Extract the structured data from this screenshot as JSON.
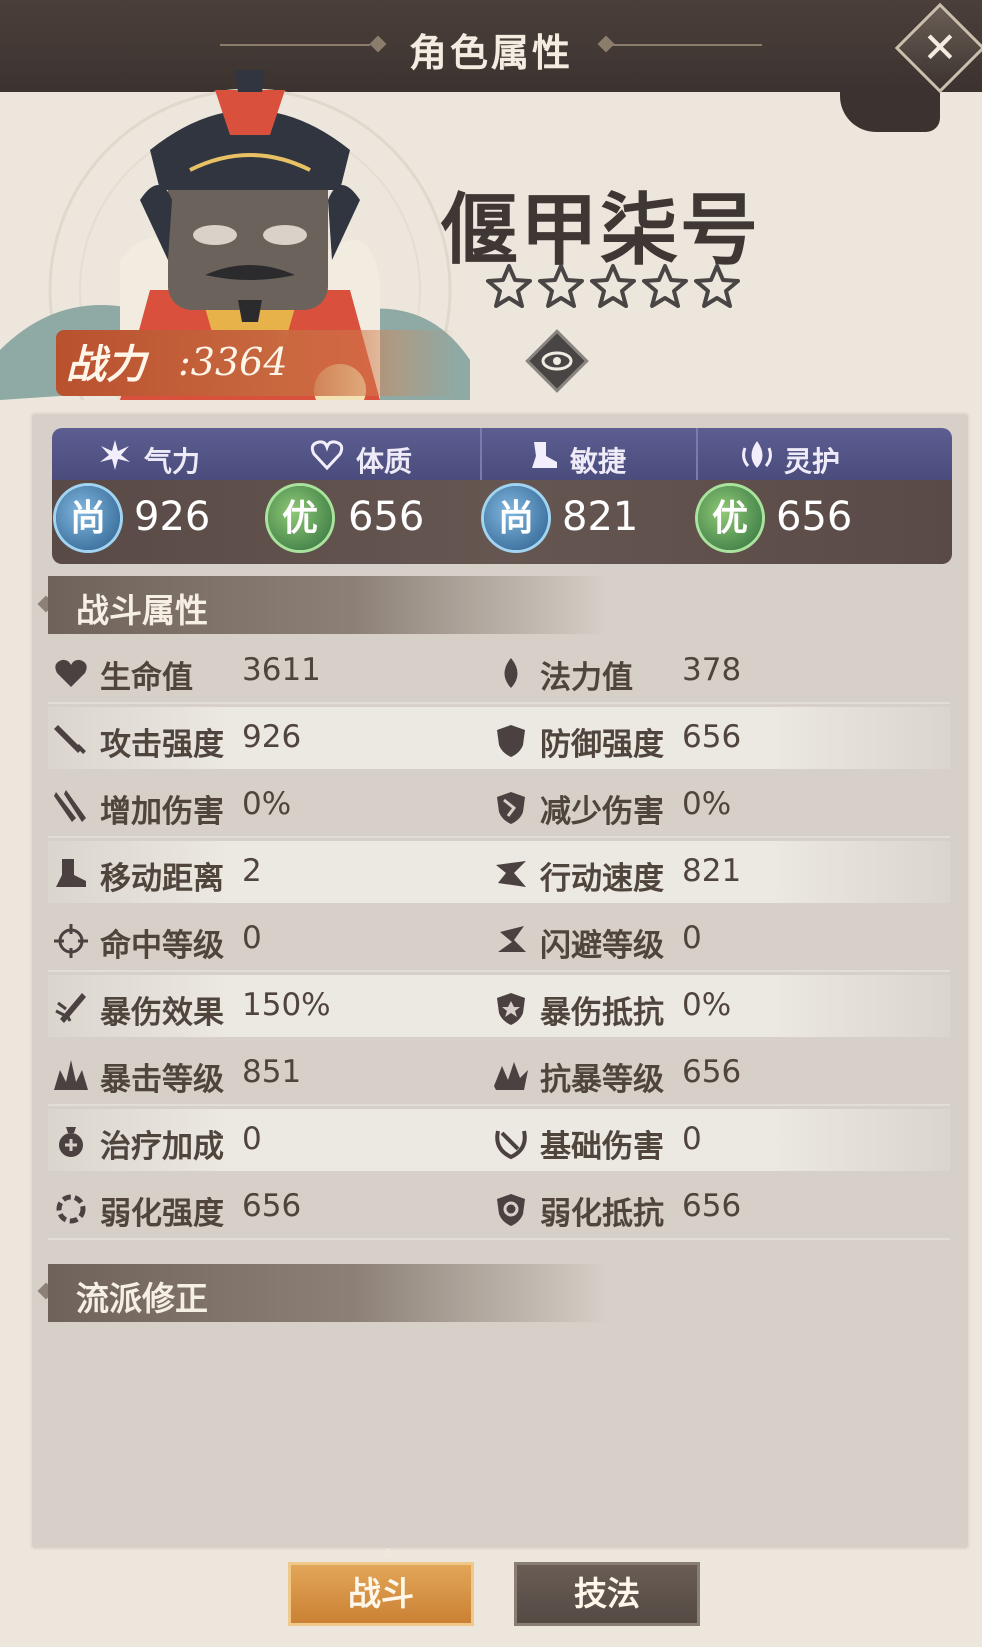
{
  "header": {
    "title": "角色属性"
  },
  "character": {
    "power_label": "战力",
    "power_value": ":3364",
    "name": "偃甲柒号",
    "star_count": 5
  },
  "attributes": [
    {
      "name": "气力",
      "icon": "qili-burst-icon",
      "grade": "尚",
      "grade_color": "blue",
      "value": "926"
    },
    {
      "name": "体质",
      "icon": "heart-outline-icon",
      "grade": "优",
      "grade_color": "green",
      "value": "656"
    },
    {
      "name": "敏捷",
      "icon": "boot-icon",
      "grade": "尚",
      "grade_color": "blue",
      "value": "821"
    },
    {
      "name": "灵护",
      "icon": "spirit-drop-icon",
      "grade": "优",
      "grade_color": "green",
      "value": "656"
    }
  ],
  "sections": {
    "combat": "战斗属性",
    "school": "流派修正"
  },
  "combat_stats": [
    {
      "left": {
        "icon": "heart-icon",
        "label": "生命值",
        "value": "3611"
      },
      "right": {
        "icon": "water-drop-icon",
        "label": "法力值",
        "value": "378"
      }
    },
    {
      "left": {
        "icon": "sword-icon",
        "label": "攻击强度",
        "value": "926"
      },
      "right": {
        "icon": "shield-icon",
        "label": "防御强度",
        "value": "656"
      }
    },
    {
      "left": {
        "icon": "double-sword-icon",
        "label": "增加伤害",
        "value": "0%"
      },
      "right": {
        "icon": "broken-shield-icon",
        "label": "减少伤害",
        "value": "0%"
      }
    },
    {
      "left": {
        "icon": "move-boot-icon",
        "label": "移动距离",
        "value": "2"
      },
      "right": {
        "icon": "speed-icon",
        "label": "行动速度",
        "value": "821"
      }
    },
    {
      "left": {
        "icon": "crosshair-icon",
        "label": "命中等级",
        "value": "0"
      },
      "right": {
        "icon": "dodge-icon",
        "label": "闪避等级",
        "value": "0"
      }
    },
    {
      "left": {
        "icon": "crit-sword-icon",
        "label": "暴伤效果",
        "value": "150%"
      },
      "right": {
        "icon": "crit-shield-icon",
        "label": "暴伤抵抗",
        "value": "0%"
      }
    },
    {
      "left": {
        "icon": "crit-burst-icon",
        "label": "暴击等级",
        "value": "851"
      },
      "right": {
        "icon": "anti-crit-icon",
        "label": "抗暴等级",
        "value": "656"
      }
    },
    {
      "left": {
        "icon": "heal-icon",
        "label": "治疗加成",
        "value": "0"
      },
      "right": {
        "icon": "base-damage-icon",
        "label": "基础伤害",
        "value": "0"
      }
    },
    {
      "left": {
        "icon": "weaken-icon",
        "label": "弱化强度",
        "value": "656"
      },
      "right": {
        "icon": "weaken-resist-icon",
        "label": "弱化抵抗",
        "value": "656"
      }
    }
  ],
  "tabs": [
    {
      "label": "战斗",
      "active": true
    },
    {
      "label": "技法",
      "active": false
    }
  ],
  "colors": {
    "header_bg": "#3c3330",
    "attr_head_bg": "#4a4c7c",
    "attr_body_bg": "#5a4a47",
    "grade_blue": "#2b5d8d",
    "grade_green": "#2f6f3e",
    "active_tab": "#c97f32",
    "power_banner": "#b9512f"
  }
}
